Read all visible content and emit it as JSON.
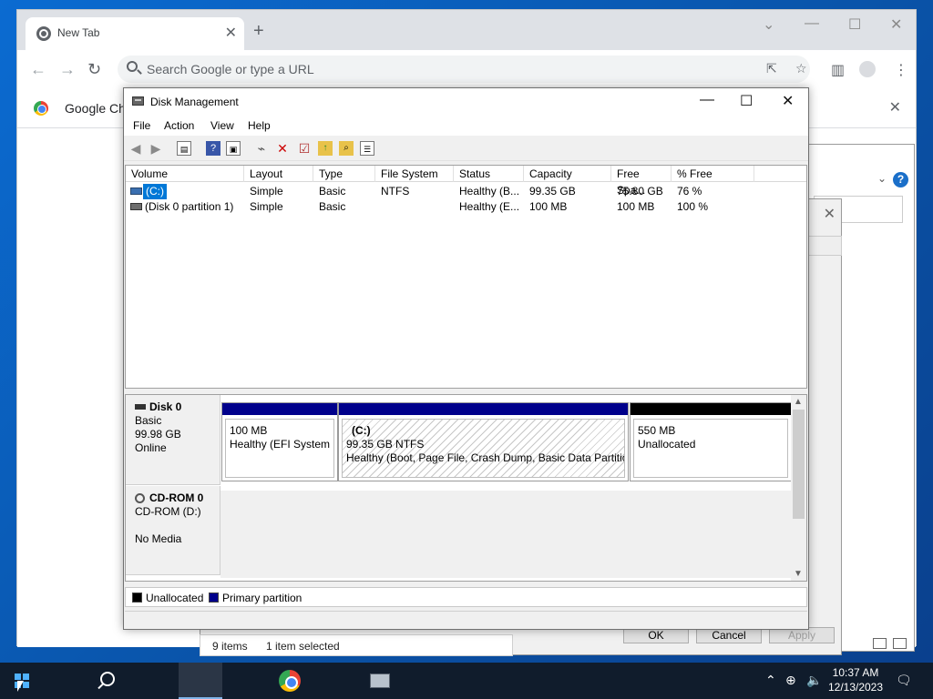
{
  "chrome": {
    "tab_title": "New Tab",
    "new_tab_glyph": "+",
    "omnibox_placeholder": "Search Google or type a URL",
    "infobar_text": "Google Chr"
  },
  "disk_management": {
    "title": "Disk Management",
    "menu": [
      "File",
      "Action",
      "View",
      "Help"
    ],
    "columns": [
      "Volume",
      "Layout",
      "Type",
      "File System",
      "Status",
      "Capacity",
      "Free Spa...",
      "% Free"
    ],
    "volumes": [
      {
        "volume": "(C:)",
        "layout": "Simple",
        "type": "Basic",
        "fs": "NTFS",
        "status": "Healthy (B...",
        "capacity": "99.35 GB",
        "free": "75.80 GB",
        "pct_free": "76 %"
      },
      {
        "volume": "(Disk 0 partition 1)",
        "layout": "Simple",
        "type": "Basic",
        "fs": "",
        "status": "Healthy (E...",
        "capacity": "100 MB",
        "free": "100 MB",
        "pct_free": "100 %"
      }
    ],
    "disk0": {
      "name": "Disk 0",
      "type": "Basic",
      "size": "99.98 GB",
      "state": "Online",
      "partitions": [
        {
          "line1": "100 MB",
          "line2": "Healthy (EFI System P",
          "bar_color": "#00008b"
        },
        {
          "label": "(C:)",
          "line1": "99.35 GB NTFS",
          "line2": "Healthy (Boot, Page File, Crash Dump, Basic Data Partition",
          "bar_color": "#00008b"
        },
        {
          "line1": "550 MB",
          "line2": "Unallocated",
          "bar_color": "#000000"
        }
      ]
    },
    "cdrom": {
      "name": "CD-ROM 0",
      "drive": "CD-ROM (D:)",
      "media": "No Media"
    },
    "legend": {
      "unallocated": "Unallocated",
      "primary": "Primary partition",
      "unallocated_color": "#000000",
      "primary_color": "#00008b"
    }
  },
  "background_dialog": {
    "ok": "OK",
    "cancel": "Cancel",
    "apply": "Apply",
    "items_count": "9 items",
    "selected": "1 item selected"
  },
  "taskbar": {
    "time": "10:37 AM",
    "date": "12/13/2023"
  }
}
